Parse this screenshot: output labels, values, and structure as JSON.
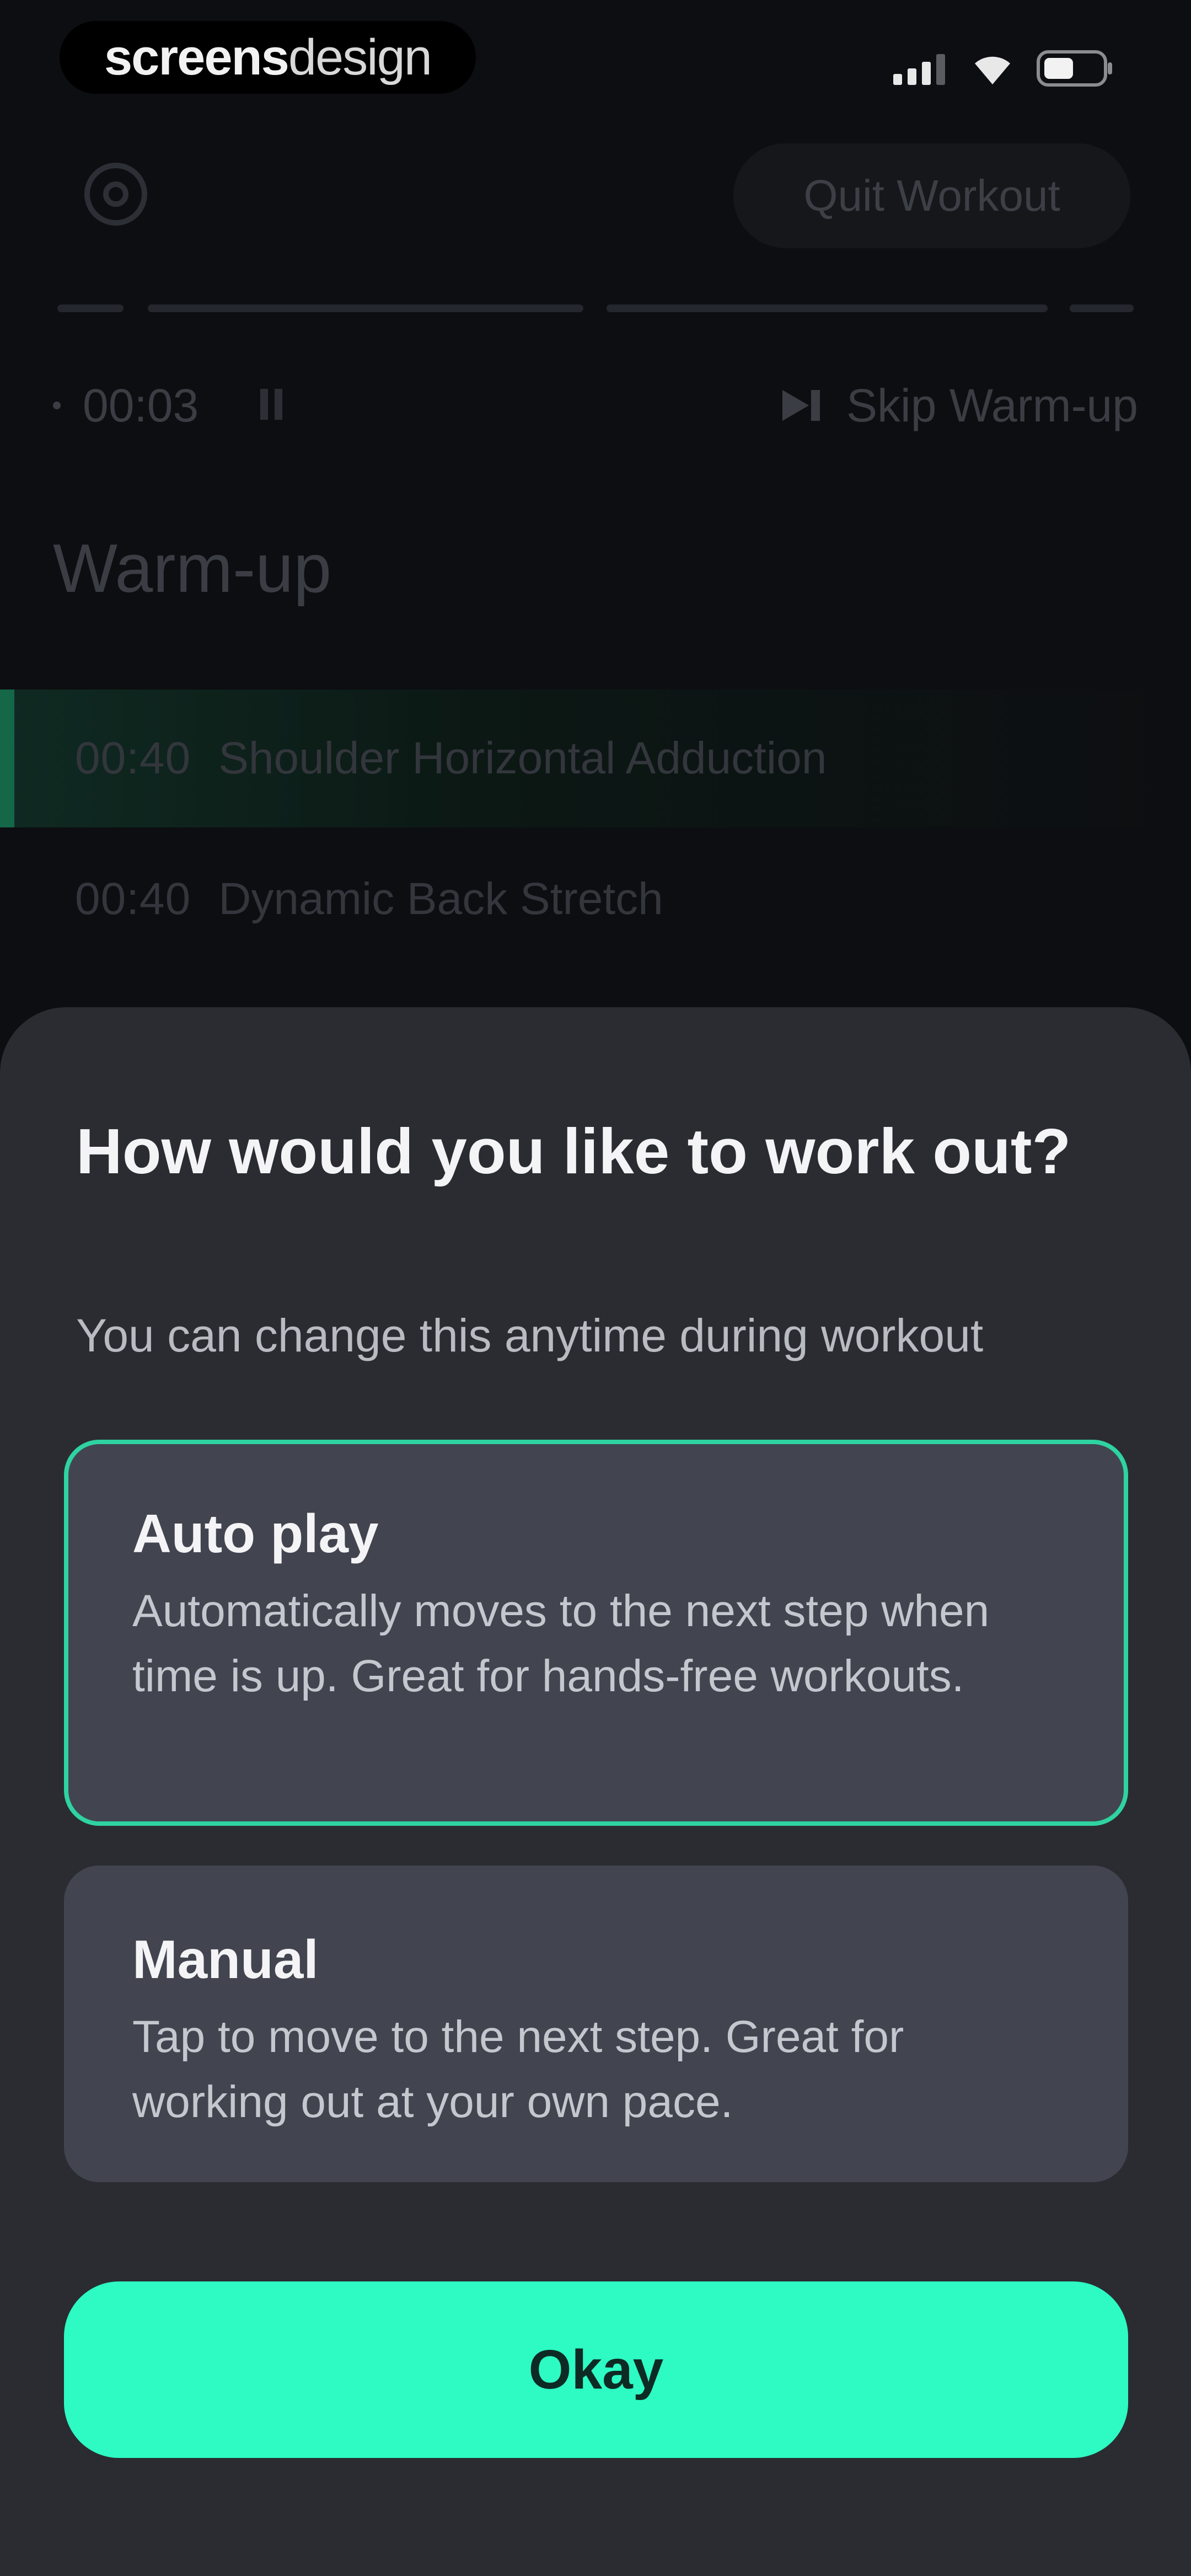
{
  "status_bar": {
    "watermark_bold": "screens",
    "watermark_light": "design"
  },
  "header": {
    "quit_label": "Quit Workout"
  },
  "timer": {
    "elapsed": "00:03",
    "skip_label": "Skip Warm-up"
  },
  "phase": {
    "title": "Warm-up",
    "steps": [
      {
        "time": "00:40",
        "name": "Shoulder Horizontal Adduction",
        "active": true
      },
      {
        "time": "00:40",
        "name": "Dynamic Back Stretch",
        "active": false
      }
    ]
  },
  "sheet": {
    "title": "How would you like to work out?",
    "subtitle": "You can change this anytime during workout",
    "options": [
      {
        "title": "Auto play",
        "description": "Automatically moves to the next step when time is up. Great for hands-free workouts.",
        "selected": true
      },
      {
        "title": "Manual",
        "description": "Tap to move to the next step. Great for working out at your own pace.",
        "selected": false
      }
    ],
    "confirm_label": "Okay"
  },
  "colors": {
    "accent": "#2dfbc3",
    "selected_border": "#2fd3a2",
    "sheet_background": "#2a2c31",
    "card_background": "#42454f",
    "screen_background": "#0d0e11"
  },
  "icons": {
    "settings": "gear-icon",
    "pause": "pause-icon",
    "skip": "skip-next-icon",
    "signal": "cellular-signal-icon",
    "wifi": "wifi-icon",
    "battery": "battery-icon"
  }
}
